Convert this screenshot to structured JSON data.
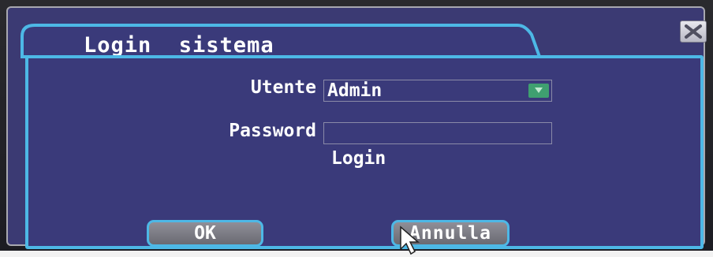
{
  "dialog": {
    "title": "Login  sistema",
    "close_icon": "close-x-icon"
  },
  "form": {
    "user_label": "Utente",
    "user_value": "Admin",
    "password_label": "Password",
    "password_value": "",
    "login_label": "Login"
  },
  "buttons": {
    "ok_label": "OK",
    "cancel_label": "Annulla"
  },
  "colors": {
    "panel_bg": "#3a3a7a",
    "accent_border": "#4db8e6",
    "dropdown_arrow_bg": "#3fa070",
    "text": "#ffffff"
  }
}
